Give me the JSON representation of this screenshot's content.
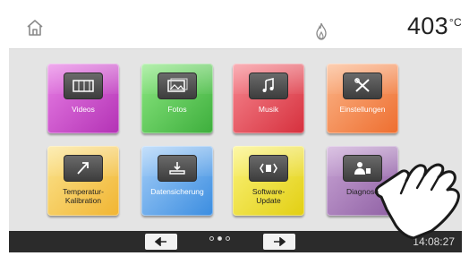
{
  "topbar": {
    "home_icon": "home-icon",
    "flame_icon": "flame-icon",
    "temperature": "403",
    "temperature_unit": "°C"
  },
  "tiles": [
    {
      "label": "Videos",
      "icon": "film-icon",
      "color": "#d455d4"
    },
    {
      "label": "Fotos",
      "icon": "photo-icon",
      "color": "#5fce5c"
    },
    {
      "label": "Musik",
      "icon": "music-note-icon",
      "color": "#e8505c"
    },
    {
      "label": "Einstellungen",
      "icon": "tools-icon",
      "color": "#f48d4f"
    },
    {
      "label": "Temperatur-\nKalibration",
      "icon": "arrow-diagonal-icon",
      "color": "#f6cb55"
    },
    {
      "label": "Datensicherung",
      "icon": "data-backup-icon",
      "color": "#5fa5ec"
    },
    {
      "label": "Software-\nUpdate",
      "icon": "update-icon",
      "color": "#f0e33a"
    },
    {
      "label": "Diagnose",
      "icon": "technician-icon",
      "color": "#a97cbb"
    }
  ],
  "bottombar": {
    "prev_label": "◀",
    "next_label": "▶",
    "page_dots": 3,
    "active_dot": 1,
    "time": "14:08:27"
  }
}
